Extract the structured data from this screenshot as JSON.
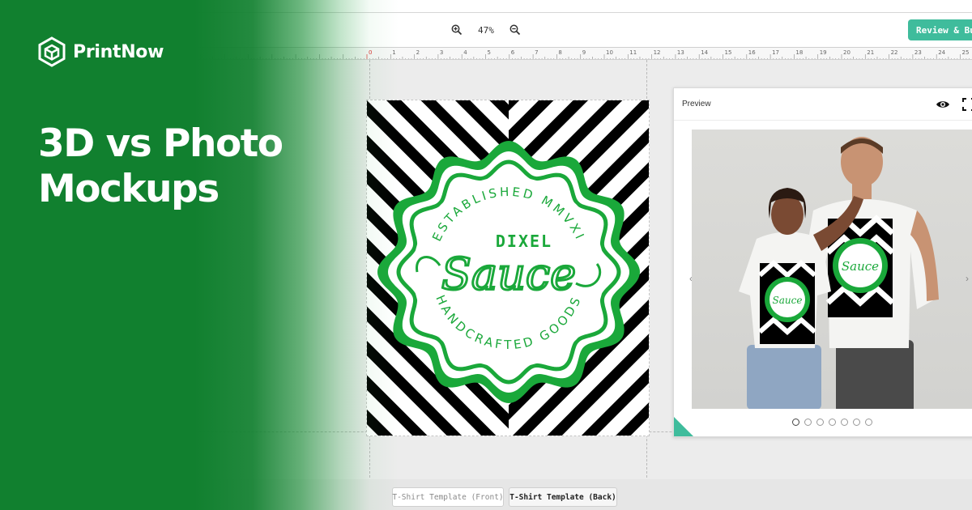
{
  "brand": {
    "name": "PrintNow",
    "logo_icon": "cube-hexagon-icon"
  },
  "headline": {
    "line1": "3D vs Photo",
    "line2": "Mockups"
  },
  "toolbar": {
    "zoom_out_icon": "zoom-out-icon",
    "zoom_in_icon": "zoom-in-icon",
    "zoom_level": "47%",
    "review_label": "Review & Buy"
  },
  "ruler": {
    "labels": [
      "0",
      "1",
      "2",
      "3",
      "4",
      "5",
      "6",
      "7",
      "8",
      "9",
      "10",
      "11",
      "12",
      "13",
      "14",
      "15",
      "16",
      "17",
      "18",
      "19",
      "20",
      "21",
      "22",
      "23",
      "24",
      "25"
    ]
  },
  "design": {
    "top_arc": "ESTABLISHED MMVXI",
    "bottom_arc": "HANDCRAFTED GOODS",
    "word_top": "DIXEL",
    "word_script": "Sauce",
    "accent_color": "#1aa83a"
  },
  "preview": {
    "title": "Preview",
    "eye_icon": "eye-icon",
    "fullscreen_icon": "fullscreen-icon",
    "prev_icon": "chevron-left-icon",
    "next_icon": "chevron-right-icon",
    "dot_count": 7,
    "active_dot": 0
  },
  "tabs": {
    "front": "T-Shirt Template (Front)",
    "back": "T-Shirt Template (Back)"
  },
  "colors": {
    "brand_green": "#11802f",
    "teal": "#3fbc9c"
  }
}
